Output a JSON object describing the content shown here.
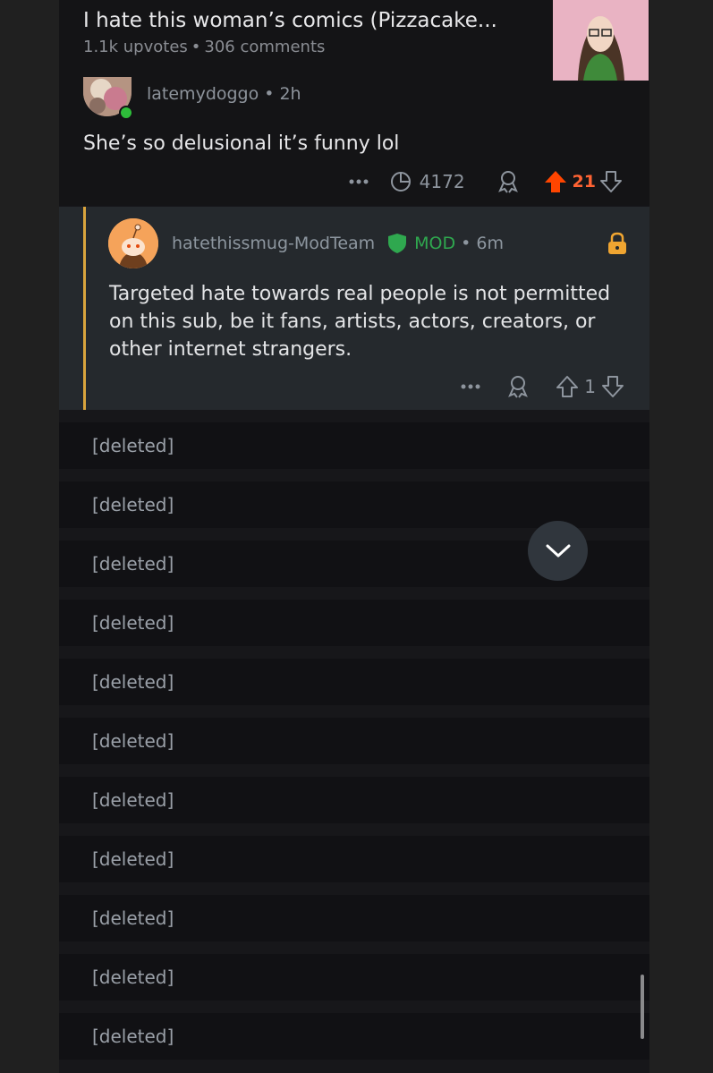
{
  "post": {
    "title": "I hate this woman’s comics (Pizzacake...",
    "upvotes": "1.1k upvotes",
    "separator": "•",
    "comments": "306 comments"
  },
  "comment": {
    "username": "latemydoggo",
    "separator": "•",
    "time": "2h",
    "body": "She’s so delusional it’s funny lol",
    "views": "4172",
    "votes": "21"
  },
  "mod_reply": {
    "username": "hatethissmug-ModTeam",
    "badge": "MOD",
    "separator": "•",
    "time": "6m",
    "body": "Targeted hate towards real people is not permitted on this sub, be it fans, artists, actors, creators, or other internet strangers.",
    "votes": "1"
  },
  "deleted": [
    "[deleted]",
    "[deleted]",
    "[deleted]",
    "[deleted]",
    "[deleted]",
    "[deleted]",
    "[deleted]",
    "[deleted]",
    "[deleted]",
    "[deleted]",
    "[deleted]"
  ],
  "colors": {
    "upvote_active": "#ff4500",
    "mod_green": "#2fa84f",
    "thread_line": "#d9a43d",
    "lock": "#f0a531"
  },
  "icons": [
    "more-icon",
    "views-icon",
    "award-icon",
    "upvote-icon",
    "downvote-icon",
    "shield-icon",
    "lock-icon",
    "chevron-down-icon"
  ]
}
